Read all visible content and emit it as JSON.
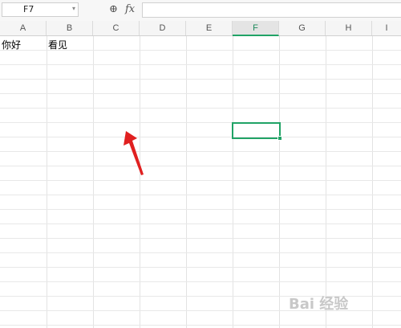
{
  "formula_bar": {
    "name_box": "F7",
    "name_box_dropdown": "▾",
    "zoom_icon": "⊕",
    "fx_label": "fx",
    "formula_value": ""
  },
  "columns": [
    "A",
    "B",
    "C",
    "D",
    "E",
    "F",
    "G",
    "H",
    "I"
  ],
  "selected_column": "F",
  "cells": {
    "A1": "你好",
    "B1": "看见"
  },
  "active_cell": "F7",
  "accent_color": "#21a366",
  "annotation": {
    "type": "red-arrow",
    "color": "#e02020"
  },
  "watermark": "Bai 经验"
}
